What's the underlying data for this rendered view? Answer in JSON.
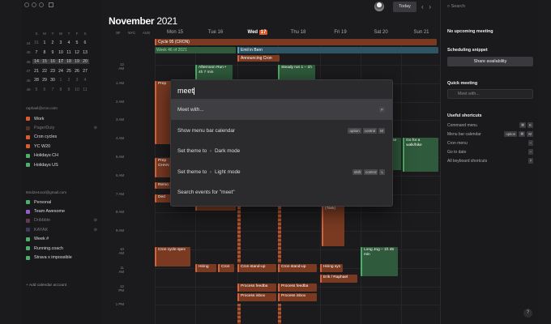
{
  "main": {
    "month": "November",
    "year": "2021",
    "today_button": "Today",
    "nav_prev": "‹",
    "nav_next": "›",
    "timezones": [
      "SF",
      "NYC",
      "AUS"
    ],
    "days": [
      {
        "label": "Mon 15"
      },
      {
        "label": "Tue 16"
      },
      {
        "label": "Wed",
        "badge": "17"
      },
      {
        "label": "Thu 18"
      },
      {
        "label": "Fri 19"
      },
      {
        "label": "Sat 20"
      },
      {
        "label": "Sun 21"
      }
    ],
    "times": [
      "12 AM",
      "1 AM",
      "2 AM",
      "3 AM",
      "4 AM",
      "5 AM",
      "6 AM",
      "7 AM",
      "8 AM",
      "9 AM",
      "10 AM",
      "11 AM",
      "12 PM",
      "1 PM"
    ],
    "allday": [
      "Cycle 95 (CRON)",
      "Week 46 of 2021",
      "Emil in Bern",
      "Announcing Cron"
    ],
    "events": {
      "afternoon_run": "Afternoon Run • 4h 7 min",
      "steady_run": "Steady run 1 – 1h",
      "prep_1": "Prep",
      "prep_chan": "Prep CHAN",
      "remo": "Remo",
      "ded": "Ded",
      "prep_2": "Prep",
      "process_inbox": "Process inbox",
      "restrat": "Restrat (Task)",
      "go_walk": "Go for a walk/hike",
      "cron_cycle": "Cron cycle spec",
      "cron_change": "Cron CHANGE",
      "hiring": "Hiring",
      "cron": "Cron",
      "cron_standup": "Cron stand-up",
      "hiring_sync": "Hiring syn",
      "erik_raphael": "Erik / Raphael",
      "long_jog": "Long Jog – 1h 45 min",
      "process_feedback": "Process feedba",
      "process_inbox_2": "Process inbox"
    }
  },
  "sidebar": {
    "mini_header": [
      "S",
      "M",
      "T",
      "W",
      "T",
      "F",
      "S"
    ],
    "mini_weeks": [
      {
        "wk": "44",
        "days": [
          "31",
          "1",
          "2",
          "3",
          "4",
          "5",
          "6"
        ]
      },
      {
        "wk": "45",
        "days": [
          "7",
          "8",
          "9",
          "10",
          "11",
          "12",
          "13"
        ]
      },
      {
        "wk": "46",
        "days": [
          "14",
          "15",
          "16",
          "17",
          "18",
          "19",
          "20"
        ]
      },
      {
        "wk": "47",
        "days": [
          "21",
          "22",
          "23",
          "24",
          "25",
          "26",
          "27"
        ]
      },
      {
        "wk": "48",
        "days": [
          "28",
          "29",
          "30",
          "1",
          "2",
          "3",
          "4"
        ]
      },
      {
        "wk": "49",
        "days": [
          "5",
          "6",
          "7",
          "8",
          "9",
          "10",
          "11"
        ]
      }
    ],
    "account1": "raphael@cron.com",
    "account1_cals": [
      {
        "label": "Work",
        "color": "#e05a2b"
      },
      {
        "label": "PagerDuty",
        "color": "#8a4a2a",
        "off": true
      },
      {
        "label": "Cron cycles",
        "color": "#e05a2b"
      },
      {
        "label": "YC W20",
        "color": "#e05a2b"
      },
      {
        "label": "Holidays CH",
        "color": "#4caf6b"
      },
      {
        "label": "Holidays US",
        "color": "#4caf6b"
      }
    ],
    "account2": "8md2e4xxxl@gmail.com",
    "account2_cals": [
      {
        "label": "Personal",
        "color": "#4caf6b"
      },
      {
        "label": "Team Awesome",
        "color": "#9b59d0"
      },
      {
        "label": "Dribbble",
        "color": "#b05a8a",
        "off": true
      },
      {
        "label": "KAYAK",
        "color": "#6a5aa0",
        "off": true
      },
      {
        "label": "Week #",
        "color": "#4caf6b"
      },
      {
        "label": "Running.coach",
        "color": "#4caf6b"
      },
      {
        "label": "Strava x impossible",
        "color": "#4caf6b"
      }
    ],
    "add_account": "+ Add calendar account"
  },
  "palette": {
    "query": "meet",
    "items": [
      {
        "label": "Meet with...",
        "keys": [
          "F"
        ]
      },
      {
        "label": "Show menu bar calendar",
        "keys": [
          "option",
          "control",
          "M"
        ]
      },
      {
        "label": "Set theme to",
        "target": "Dark mode",
        "keys": []
      },
      {
        "label": "Set theme to",
        "target": "Light mode",
        "keys": [
          "shift",
          "control",
          "L"
        ]
      },
      {
        "label": "Search events for \"meet\"",
        "keys": []
      }
    ]
  },
  "right": {
    "search": "Search",
    "no_meeting": "No upcoming meeting",
    "scheduling": "Scheduling snippet",
    "share": "Share availability",
    "quick": "Quick meeting",
    "meet_with_placeholder": "Meet with...",
    "shortcuts_title": "Useful shortcuts",
    "shortcuts": [
      {
        "name": "Command menu",
        "keys": [
          "⌘",
          "K"
        ]
      },
      {
        "name": "Menu bar calendar",
        "keys": [
          "option",
          "⌘",
          "M"
        ]
      },
      {
        "name": "Cron menu",
        "keys": [
          "–"
        ]
      },
      {
        "name": "Go to date",
        "keys": [
          "–"
        ]
      },
      {
        "name": "All keyboard shortcuts",
        "keys": [
          "?"
        ]
      }
    ],
    "help": "?"
  },
  "colors": {
    "accent": "#e05a2b",
    "green": "#4caf6b",
    "teal": "#4aa7c0"
  }
}
